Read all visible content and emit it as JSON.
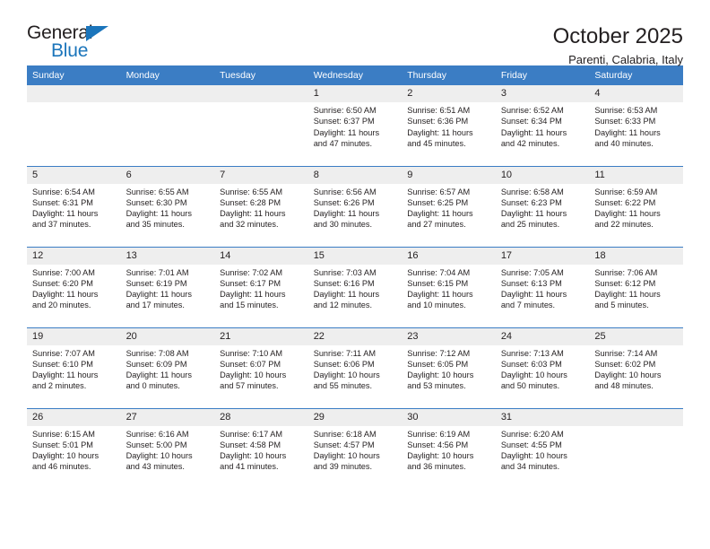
{
  "brand": {
    "name_top": "General",
    "name_bottom": "Blue",
    "triangle_color": "#1b75bb"
  },
  "header": {
    "month_title": "October 2025",
    "location": "Parenti, Calabria, Italy"
  },
  "theme": {
    "header_blue": "#3b7dc4",
    "daynum_band": "#eeeeee",
    "text": "#231f20"
  },
  "calendar": {
    "day_headers": [
      "Sunday",
      "Monday",
      "Tuesday",
      "Wednesday",
      "Thursday",
      "Friday",
      "Saturday"
    ],
    "weeks": [
      [
        {
          "empty": true
        },
        {
          "empty": true
        },
        {
          "empty": true
        },
        {
          "day": "1",
          "sunrise": "Sunrise: 6:50 AM",
          "sunset": "Sunset: 6:37 PM",
          "daylight_1": "Daylight: 11 hours",
          "daylight_2": "and 47 minutes."
        },
        {
          "day": "2",
          "sunrise": "Sunrise: 6:51 AM",
          "sunset": "Sunset: 6:36 PM",
          "daylight_1": "Daylight: 11 hours",
          "daylight_2": "and 45 minutes."
        },
        {
          "day": "3",
          "sunrise": "Sunrise: 6:52 AM",
          "sunset": "Sunset: 6:34 PM",
          "daylight_1": "Daylight: 11 hours",
          "daylight_2": "and 42 minutes."
        },
        {
          "day": "4",
          "sunrise": "Sunrise: 6:53 AM",
          "sunset": "Sunset: 6:33 PM",
          "daylight_1": "Daylight: 11 hours",
          "daylight_2": "and 40 minutes."
        }
      ],
      [
        {
          "day": "5",
          "sunrise": "Sunrise: 6:54 AM",
          "sunset": "Sunset: 6:31 PM",
          "daylight_1": "Daylight: 11 hours",
          "daylight_2": "and 37 minutes."
        },
        {
          "day": "6",
          "sunrise": "Sunrise: 6:55 AM",
          "sunset": "Sunset: 6:30 PM",
          "daylight_1": "Daylight: 11 hours",
          "daylight_2": "and 35 minutes."
        },
        {
          "day": "7",
          "sunrise": "Sunrise: 6:55 AM",
          "sunset": "Sunset: 6:28 PM",
          "daylight_1": "Daylight: 11 hours",
          "daylight_2": "and 32 minutes."
        },
        {
          "day": "8",
          "sunrise": "Sunrise: 6:56 AM",
          "sunset": "Sunset: 6:26 PM",
          "daylight_1": "Daylight: 11 hours",
          "daylight_2": "and 30 minutes."
        },
        {
          "day": "9",
          "sunrise": "Sunrise: 6:57 AM",
          "sunset": "Sunset: 6:25 PM",
          "daylight_1": "Daylight: 11 hours",
          "daylight_2": "and 27 minutes."
        },
        {
          "day": "10",
          "sunrise": "Sunrise: 6:58 AM",
          "sunset": "Sunset: 6:23 PM",
          "daylight_1": "Daylight: 11 hours",
          "daylight_2": "and 25 minutes."
        },
        {
          "day": "11",
          "sunrise": "Sunrise: 6:59 AM",
          "sunset": "Sunset: 6:22 PM",
          "daylight_1": "Daylight: 11 hours",
          "daylight_2": "and 22 minutes."
        }
      ],
      [
        {
          "day": "12",
          "sunrise": "Sunrise: 7:00 AM",
          "sunset": "Sunset: 6:20 PM",
          "daylight_1": "Daylight: 11 hours",
          "daylight_2": "and 20 minutes."
        },
        {
          "day": "13",
          "sunrise": "Sunrise: 7:01 AM",
          "sunset": "Sunset: 6:19 PM",
          "daylight_1": "Daylight: 11 hours",
          "daylight_2": "and 17 minutes."
        },
        {
          "day": "14",
          "sunrise": "Sunrise: 7:02 AM",
          "sunset": "Sunset: 6:17 PM",
          "daylight_1": "Daylight: 11 hours",
          "daylight_2": "and 15 minutes."
        },
        {
          "day": "15",
          "sunrise": "Sunrise: 7:03 AM",
          "sunset": "Sunset: 6:16 PM",
          "daylight_1": "Daylight: 11 hours",
          "daylight_2": "and 12 minutes."
        },
        {
          "day": "16",
          "sunrise": "Sunrise: 7:04 AM",
          "sunset": "Sunset: 6:15 PM",
          "daylight_1": "Daylight: 11 hours",
          "daylight_2": "and 10 minutes."
        },
        {
          "day": "17",
          "sunrise": "Sunrise: 7:05 AM",
          "sunset": "Sunset: 6:13 PM",
          "daylight_1": "Daylight: 11 hours",
          "daylight_2": "and 7 minutes."
        },
        {
          "day": "18",
          "sunrise": "Sunrise: 7:06 AM",
          "sunset": "Sunset: 6:12 PM",
          "daylight_1": "Daylight: 11 hours",
          "daylight_2": "and 5 minutes."
        }
      ],
      [
        {
          "day": "19",
          "sunrise": "Sunrise: 7:07 AM",
          "sunset": "Sunset: 6:10 PM",
          "daylight_1": "Daylight: 11 hours",
          "daylight_2": "and 2 minutes."
        },
        {
          "day": "20",
          "sunrise": "Sunrise: 7:08 AM",
          "sunset": "Sunset: 6:09 PM",
          "daylight_1": "Daylight: 11 hours",
          "daylight_2": "and 0 minutes."
        },
        {
          "day": "21",
          "sunrise": "Sunrise: 7:10 AM",
          "sunset": "Sunset: 6:07 PM",
          "daylight_1": "Daylight: 10 hours",
          "daylight_2": "and 57 minutes."
        },
        {
          "day": "22",
          "sunrise": "Sunrise: 7:11 AM",
          "sunset": "Sunset: 6:06 PM",
          "daylight_1": "Daylight: 10 hours",
          "daylight_2": "and 55 minutes."
        },
        {
          "day": "23",
          "sunrise": "Sunrise: 7:12 AM",
          "sunset": "Sunset: 6:05 PM",
          "daylight_1": "Daylight: 10 hours",
          "daylight_2": "and 53 minutes."
        },
        {
          "day": "24",
          "sunrise": "Sunrise: 7:13 AM",
          "sunset": "Sunset: 6:03 PM",
          "daylight_1": "Daylight: 10 hours",
          "daylight_2": "and 50 minutes."
        },
        {
          "day": "25",
          "sunrise": "Sunrise: 7:14 AM",
          "sunset": "Sunset: 6:02 PM",
          "daylight_1": "Daylight: 10 hours",
          "daylight_2": "and 48 minutes."
        }
      ],
      [
        {
          "day": "26",
          "sunrise": "Sunrise: 6:15 AM",
          "sunset": "Sunset: 5:01 PM",
          "daylight_1": "Daylight: 10 hours",
          "daylight_2": "and 46 minutes."
        },
        {
          "day": "27",
          "sunrise": "Sunrise: 6:16 AM",
          "sunset": "Sunset: 5:00 PM",
          "daylight_1": "Daylight: 10 hours",
          "daylight_2": "and 43 minutes."
        },
        {
          "day": "28",
          "sunrise": "Sunrise: 6:17 AM",
          "sunset": "Sunset: 4:58 PM",
          "daylight_1": "Daylight: 10 hours",
          "daylight_2": "and 41 minutes."
        },
        {
          "day": "29",
          "sunrise": "Sunrise: 6:18 AM",
          "sunset": "Sunset: 4:57 PM",
          "daylight_1": "Daylight: 10 hours",
          "daylight_2": "and 39 minutes."
        },
        {
          "day": "30",
          "sunrise": "Sunrise: 6:19 AM",
          "sunset": "Sunset: 4:56 PM",
          "daylight_1": "Daylight: 10 hours",
          "daylight_2": "and 36 minutes."
        },
        {
          "day": "31",
          "sunrise": "Sunrise: 6:20 AM",
          "sunset": "Sunset: 4:55 PM",
          "daylight_1": "Daylight: 10 hours",
          "daylight_2": "and 34 minutes."
        },
        {
          "empty": true
        }
      ]
    ]
  }
}
